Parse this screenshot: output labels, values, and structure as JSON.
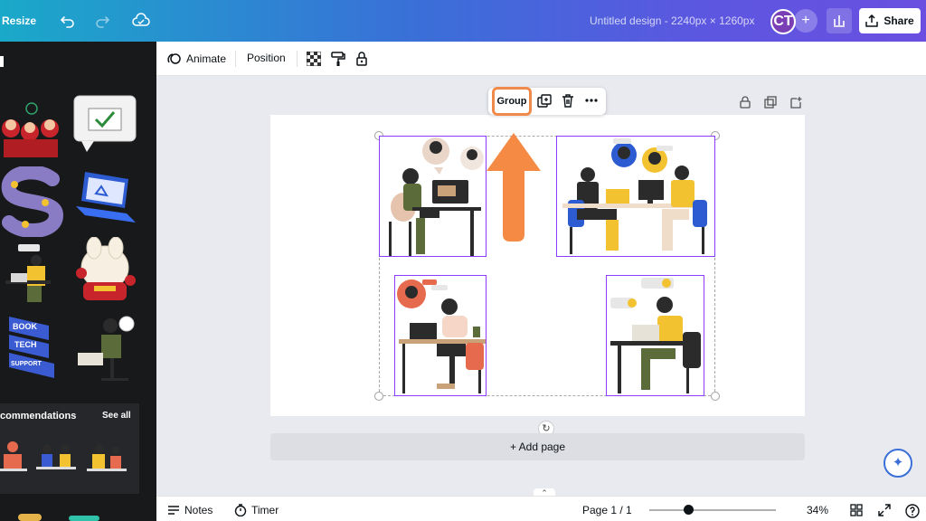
{
  "topbar": {
    "resize_label": "Resize",
    "doc_title": "Untitled design - 2240px × 1260px",
    "avatar_initials": "CT",
    "avatar_plus": "+",
    "share_label": "Share"
  },
  "left_panel": {
    "recommendations_label": "commendations",
    "see_all_label": "See all",
    "tiles": [
      "new-year-kids",
      "check-speech-bubble",
      "letter-s-balloon",
      "laptop-warning",
      "remote-worker",
      "lucky-rabbit",
      "book-tech-support-sign",
      "support-agent"
    ],
    "recommendation_tiles": [
      "office-team-a",
      "office-team-b",
      "office-team-c"
    ]
  },
  "toolbar": {
    "animate_label": "Animate",
    "position_label": "Position"
  },
  "canvas": {
    "group_label": "Group",
    "add_page_label": "+ Add page",
    "illustrations": [
      "woman-video-call",
      "team-meeting-desk",
      "woman-laptop-chat",
      "support-worker-desk"
    ],
    "highlight_color": "#f08a4b",
    "selection_color": "#8b3dff"
  },
  "bottombar": {
    "notes_label": "Notes",
    "timer_label": "Timer",
    "page_indicator": "Page 1 / 1",
    "zoom_level": "34%",
    "zoom_fraction": 0.31
  }
}
